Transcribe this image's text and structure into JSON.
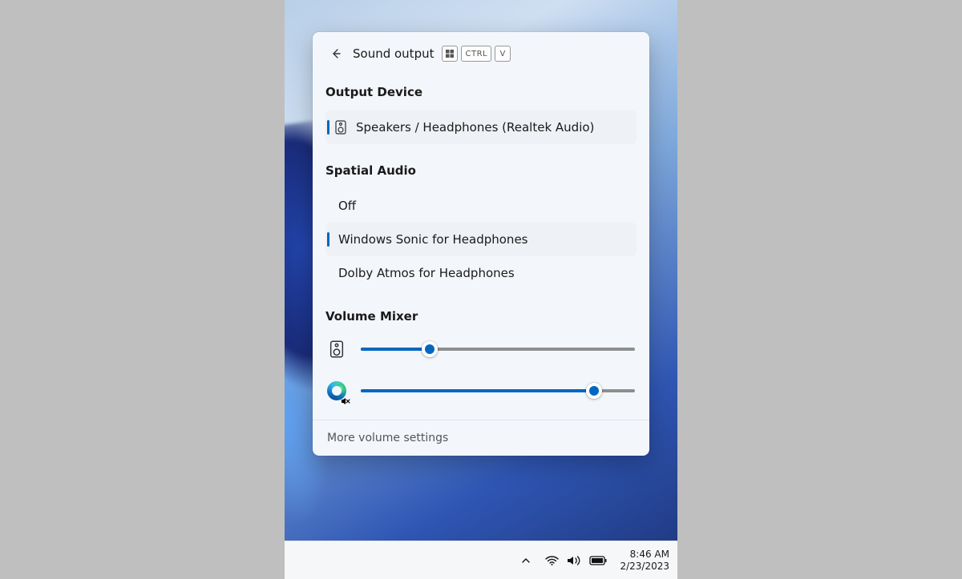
{
  "flyout": {
    "title": "Sound output",
    "shortcut_keys": [
      "WIN",
      "CTRL",
      "V"
    ],
    "sections": {
      "output_device": {
        "heading": "Output Device",
        "items": [
          {
            "label": "Speakers / Headphones (Realtek Audio)",
            "selected": true
          }
        ]
      },
      "spatial_audio": {
        "heading": "Spatial Audio",
        "items": [
          {
            "label": "Off",
            "selected": false
          },
          {
            "label": "Windows Sonic for Headphones",
            "selected": true
          },
          {
            "label": "Dolby Atmos for Headphones",
            "selected": false
          }
        ]
      },
      "volume_mixer": {
        "heading": "Volume Mixer",
        "channels": [
          {
            "app": "System Speaker",
            "icon": "speaker-icon",
            "value": 25,
            "muted": false
          },
          {
            "app": "Microsoft Edge",
            "icon": "edge-icon",
            "value": 85,
            "muted": true
          }
        ]
      }
    },
    "footer_link": "More volume settings"
  },
  "taskbar": {
    "time": "8:46 AM",
    "date": "2/23/2023"
  },
  "colors": {
    "accent": "#0067c0"
  }
}
